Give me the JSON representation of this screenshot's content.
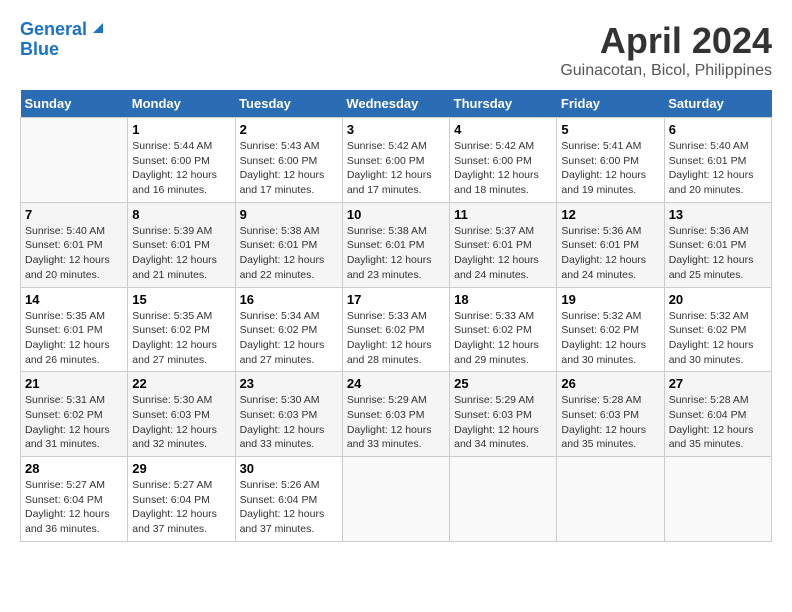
{
  "header": {
    "logo_line1": "General",
    "logo_line2": "Blue",
    "title": "April 2024",
    "subtitle": "Guinacotan, Bicol, Philippines"
  },
  "calendar": {
    "days_of_week": [
      "Sunday",
      "Monday",
      "Tuesday",
      "Wednesday",
      "Thursday",
      "Friday",
      "Saturday"
    ],
    "weeks": [
      [
        {
          "day": "",
          "empty": true
        },
        {
          "day": "1",
          "sunrise": "5:44 AM",
          "sunset": "6:00 PM",
          "daylight": "12 hours and 16 minutes."
        },
        {
          "day": "2",
          "sunrise": "5:43 AM",
          "sunset": "6:00 PM",
          "daylight": "12 hours and 17 minutes."
        },
        {
          "day": "3",
          "sunrise": "5:42 AM",
          "sunset": "6:00 PM",
          "daylight": "12 hours and 17 minutes."
        },
        {
          "day": "4",
          "sunrise": "5:42 AM",
          "sunset": "6:00 PM",
          "daylight": "12 hours and 18 minutes."
        },
        {
          "day": "5",
          "sunrise": "5:41 AM",
          "sunset": "6:00 PM",
          "daylight": "12 hours and 19 minutes."
        },
        {
          "day": "6",
          "sunrise": "5:40 AM",
          "sunset": "6:01 PM",
          "daylight": "12 hours and 20 minutes."
        }
      ],
      [
        {
          "day": "7",
          "sunrise": "5:40 AM",
          "sunset": "6:01 PM",
          "daylight": "12 hours and 20 minutes."
        },
        {
          "day": "8",
          "sunrise": "5:39 AM",
          "sunset": "6:01 PM",
          "daylight": "12 hours and 21 minutes."
        },
        {
          "day": "9",
          "sunrise": "5:38 AM",
          "sunset": "6:01 PM",
          "daylight": "12 hours and 22 minutes."
        },
        {
          "day": "10",
          "sunrise": "5:38 AM",
          "sunset": "6:01 PM",
          "daylight": "12 hours and 23 minutes."
        },
        {
          "day": "11",
          "sunrise": "5:37 AM",
          "sunset": "6:01 PM",
          "daylight": "12 hours and 24 minutes."
        },
        {
          "day": "12",
          "sunrise": "5:36 AM",
          "sunset": "6:01 PM",
          "daylight": "12 hours and 24 minutes."
        },
        {
          "day": "13",
          "sunrise": "5:36 AM",
          "sunset": "6:01 PM",
          "daylight": "12 hours and 25 minutes."
        }
      ],
      [
        {
          "day": "14",
          "sunrise": "5:35 AM",
          "sunset": "6:01 PM",
          "daylight": "12 hours and 26 minutes."
        },
        {
          "day": "15",
          "sunrise": "5:35 AM",
          "sunset": "6:02 PM",
          "daylight": "12 hours and 27 minutes."
        },
        {
          "day": "16",
          "sunrise": "5:34 AM",
          "sunset": "6:02 PM",
          "daylight": "12 hours and 27 minutes."
        },
        {
          "day": "17",
          "sunrise": "5:33 AM",
          "sunset": "6:02 PM",
          "daylight": "12 hours and 28 minutes."
        },
        {
          "day": "18",
          "sunrise": "5:33 AM",
          "sunset": "6:02 PM",
          "daylight": "12 hours and 29 minutes."
        },
        {
          "day": "19",
          "sunrise": "5:32 AM",
          "sunset": "6:02 PM",
          "daylight": "12 hours and 30 minutes."
        },
        {
          "day": "20",
          "sunrise": "5:32 AM",
          "sunset": "6:02 PM",
          "daylight": "12 hours and 30 minutes."
        }
      ],
      [
        {
          "day": "21",
          "sunrise": "5:31 AM",
          "sunset": "6:02 PM",
          "daylight": "12 hours and 31 minutes."
        },
        {
          "day": "22",
          "sunrise": "5:30 AM",
          "sunset": "6:03 PM",
          "daylight": "12 hours and 32 minutes."
        },
        {
          "day": "23",
          "sunrise": "5:30 AM",
          "sunset": "6:03 PM",
          "daylight": "12 hours and 33 minutes."
        },
        {
          "day": "24",
          "sunrise": "5:29 AM",
          "sunset": "6:03 PM",
          "daylight": "12 hours and 33 minutes."
        },
        {
          "day": "25",
          "sunrise": "5:29 AM",
          "sunset": "6:03 PM",
          "daylight": "12 hours and 34 minutes."
        },
        {
          "day": "26",
          "sunrise": "5:28 AM",
          "sunset": "6:03 PM",
          "daylight": "12 hours and 35 minutes."
        },
        {
          "day": "27",
          "sunrise": "5:28 AM",
          "sunset": "6:04 PM",
          "daylight": "12 hours and 35 minutes."
        }
      ],
      [
        {
          "day": "28",
          "sunrise": "5:27 AM",
          "sunset": "6:04 PM",
          "daylight": "12 hours and 36 minutes."
        },
        {
          "day": "29",
          "sunrise": "5:27 AM",
          "sunset": "6:04 PM",
          "daylight": "12 hours and 37 minutes."
        },
        {
          "day": "30",
          "sunrise": "5:26 AM",
          "sunset": "6:04 PM",
          "daylight": "12 hours and 37 minutes."
        },
        {
          "day": "",
          "empty": true
        },
        {
          "day": "",
          "empty": true
        },
        {
          "day": "",
          "empty": true
        },
        {
          "day": "",
          "empty": true
        }
      ]
    ]
  },
  "labels": {
    "sunrise": "Sunrise:",
    "sunset": "Sunset:",
    "daylight": "Daylight:"
  }
}
